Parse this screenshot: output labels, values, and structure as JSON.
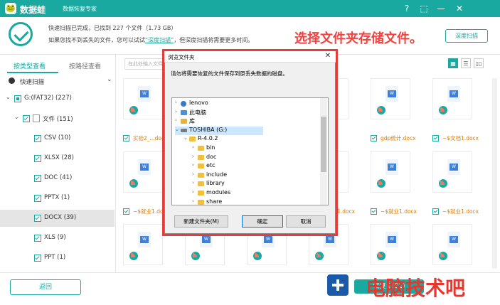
{
  "app": {
    "name": "数据蛙",
    "edition": "数据恢复专家",
    "logo_icon": "frog-logo-icon",
    "accent": "#1aa9a0",
    "controls": [
      "?",
      "⬚",
      "—",
      "✕"
    ]
  },
  "status": {
    "line1": "快速扫描已完成，已找到  227  个文件（1.73 GB）",
    "line2_prefix": "如果您找不到丢失的文件，您可以试试",
    "deep_link": "“深度扫描”",
    "line2_suffix": "，但深度扫描将需要更多时间。",
    "deep_scan_button": "深度扫描"
  },
  "annotation": {
    "note": "选择文件夹存储文件。",
    "color": "#f5413d"
  },
  "left_panel": {
    "tabs": [
      "按类型查看",
      "按路径查看"
    ],
    "quick_scan": "快速扫描",
    "tree": [
      {
        "label": "G:(FAT32) (227)",
        "level": 0,
        "state": "part"
      },
      {
        "label": "文件 (151)",
        "level": 1,
        "state": "on"
      },
      {
        "label": "CSV (10)",
        "level": 2,
        "state": "on"
      },
      {
        "label": "XLSX (28)",
        "level": 2,
        "state": "on"
      },
      {
        "label": "DOC (41)",
        "level": 2,
        "state": "on"
      },
      {
        "label": "PPTX (1)",
        "level": 2,
        "state": "on"
      },
      {
        "label": "DOCX (39)",
        "level": 2,
        "state": "on",
        "selected": true
      },
      {
        "label": "XLS (9)",
        "level": 2,
        "state": "on"
      },
      {
        "label": "PPT (1)",
        "level": 2,
        "state": "on"
      }
    ]
  },
  "toolbar": {
    "search_placeholder": "在此处输入文件名",
    "views": [
      "▦",
      "☰",
      "▯▯"
    ]
  },
  "files": {
    "row1": [
      "实验2_...docx",
      "",
      "",
      "gdp统计.docx",
      "~$文档1.docx"
    ],
    "row2": [
      "~$就业1.docx",
      "",
      "",
      "~$就业1.docx",
      "~$就业1.docx",
      "~$就业1.docx"
    ]
  },
  "bottom": {
    "back_button": "返回",
    "recover_button": "恢复 (151)"
  },
  "watermark": {
    "text": "电脑技术吧"
  },
  "dialog": {
    "title": "浏览文件夹",
    "close": "✕",
    "prompt": "请勿将需要恢复的文件保存到原丢失数据的磁盘。",
    "items": [
      {
        "label": "lenovo",
        "level": 0,
        "icon": "user-folder-icon"
      },
      {
        "label": "此电脑",
        "level": 0,
        "icon": "computer-icon"
      },
      {
        "label": "库",
        "level": 0,
        "icon": "library-icon"
      },
      {
        "label": "TOSHIBA (G:)",
        "level": 0,
        "icon": "drive-icon",
        "selected": true,
        "expanded": true
      },
      {
        "label": "R-4.0.2",
        "level": 1,
        "icon": "folder-icon",
        "expanded": true
      },
      {
        "label": "bin",
        "level": 2,
        "icon": "folder-icon"
      },
      {
        "label": "doc",
        "level": 2,
        "icon": "folder-icon"
      },
      {
        "label": "etc",
        "level": 2,
        "icon": "folder-icon"
      },
      {
        "label": "include",
        "level": 2,
        "icon": "folder-icon"
      },
      {
        "label": "library",
        "level": 2,
        "icon": "folder-icon"
      },
      {
        "label": "modules",
        "level": 2,
        "icon": "folder-icon"
      },
      {
        "label": "share",
        "level": 2,
        "icon": "folder-icon"
      }
    ],
    "new_folder_button": "新建文件夹(M)",
    "ok_button": "确定",
    "cancel_button": "取消"
  }
}
